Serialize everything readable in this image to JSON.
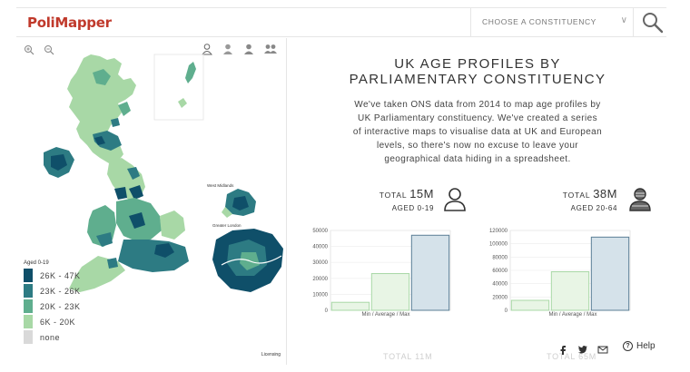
{
  "header": {
    "logo": "PoliMapper",
    "select_label": "CHOOSE A CONSTITUENCY",
    "select_chevron": "∨"
  },
  "map": {
    "legend_title": "Aged 0-19",
    "legend": [
      {
        "label": "26K - 47K",
        "color": "#0f4f69"
      },
      {
        "label": "23K - 26K",
        "color": "#2d7b83"
      },
      {
        "label": "20K - 23K",
        "color": "#5fae8e"
      },
      {
        "label": "6K - 20K",
        "color": "#a8d8a6"
      },
      {
        "label": "none",
        "color": "#d9d9d9"
      }
    ],
    "inset_labels": [
      "West Midlands",
      "Greater London"
    ],
    "licensing": "Licensing",
    "icons": [
      "zoom-in-icon",
      "zoom-out-icon",
      "age-0-19-icon",
      "age-20-64-icon",
      "age-65-plus-icon",
      "all-ages-icon"
    ]
  },
  "content": {
    "title_line1": "UK AGE PROFILES BY",
    "title_line2": "PARLIAMENTARY CONSTITUENCY",
    "desc_line1": "We've taken ONS data from 2014 to map age profiles by",
    "desc_line2": "UK Parliamentary constituency. We've created a series",
    "desc_line3": "of interactive maps to visualise data at UK and European",
    "desc_line4": "levels, so there's now no excuse to leave your",
    "desc_line5": "geographical data hiding in a spreadsheet.",
    "stat1": {
      "total_label": "TOTAL",
      "total_value": "15M",
      "age": "AGED 0-19"
    },
    "stat2": {
      "total_label": "TOTAL",
      "total_value": "38M",
      "age": "AGED 20-64"
    },
    "ghost1": "TOTAL 11M",
    "ghost2": "TOTAL 65M",
    "help": "Help",
    "social_icons": [
      "facebook-icon",
      "twitter-icon",
      "email-icon"
    ]
  },
  "chart_data": [
    {
      "type": "bar",
      "categories": [
        "Min",
        "Average",
        "Max"
      ],
      "values": [
        5000,
        23000,
        47000
      ],
      "xlabel": "Min / Average / Max",
      "ylim": [
        0,
        50000
      ],
      "yticks": [
        "0",
        "10000",
        "20000",
        "30000",
        "40000",
        "50000"
      ],
      "colors": [
        "#e8f5e5",
        "#e8f5e5",
        "#d5e2ea"
      ],
      "strokes": [
        "#a8d8a6",
        "#a8d8a6",
        "#5b7f96"
      ]
    },
    {
      "type": "bar",
      "categories": [
        "Min",
        "Average",
        "Max"
      ],
      "values": [
        15000,
        58000,
        110000
      ],
      "xlabel": "Min / Average / Max",
      "ylim": [
        0,
        120000
      ],
      "yticks": [
        "0",
        "20000",
        "40000",
        "60000",
        "80000",
        "100000",
        "120000"
      ],
      "colors": [
        "#e8f5e5",
        "#e8f5e5",
        "#d5e2ea"
      ],
      "strokes": [
        "#a8d8a6",
        "#a8d8a6",
        "#5b7f96"
      ]
    }
  ]
}
